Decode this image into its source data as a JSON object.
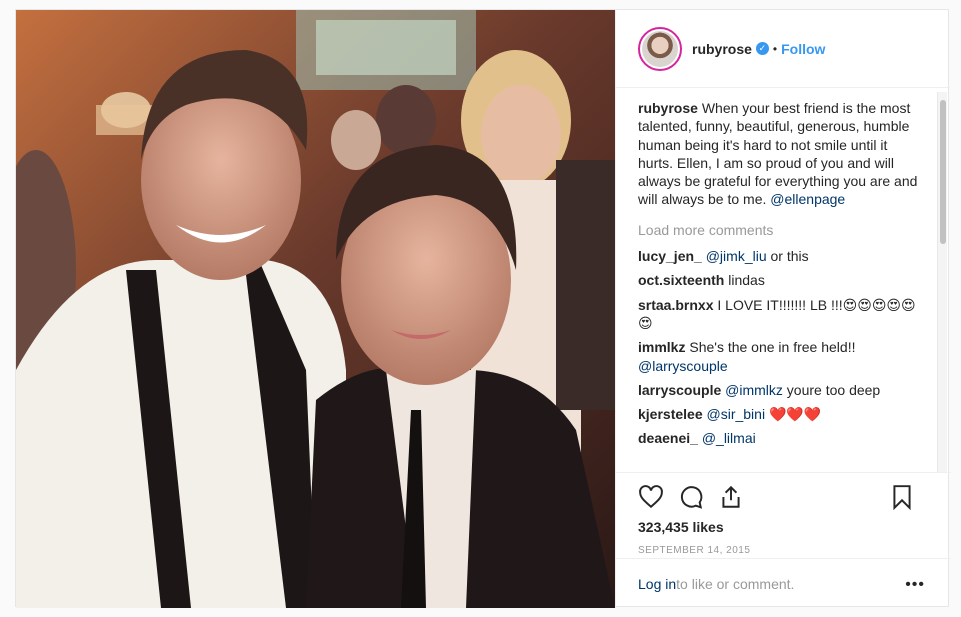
{
  "post": {
    "username": "rubyrose",
    "follow_label": "Follow",
    "caption_user": "rubyrose",
    "caption_text": "When your best friend is the most talented, funny, beautiful, generous, humble human being it's hard to not smile until it hurts. Ellen, I am so proud of you and will always be grateful for everything you are and will always be to me.",
    "caption_mention": "@ellenpage",
    "load_more": "Load more comments",
    "comments": [
      {
        "user": "lucy_jen_",
        "mention": "@jimk_liu",
        "text": " or this"
      },
      {
        "user": "oct.sixteenth",
        "mention": "",
        "text": " lindas"
      },
      {
        "user": "srtaa.brnxx",
        "mention": "",
        "text": " I LOVE IT!!!!!!! LB !!!😍😍😍😍😍😍"
      },
      {
        "user": "immlkz",
        "mention": "",
        "text": " She's the one in free held!!",
        "mention2": "@larryscouple"
      },
      {
        "user": "larryscouple",
        "mention": "@immlkz",
        "text": " youre too deep"
      },
      {
        "user": "kjerstelee",
        "mention": "@sir_bini",
        "text": " ❤️❤️❤️"
      },
      {
        "user": "deaenei_",
        "mention": "@_lilmai",
        "text": ""
      }
    ],
    "likes": "323,435 likes",
    "date": "SEPTEMBER 14, 2015",
    "login_link": "Log in",
    "login_rest": " to like or comment.",
    "more_options": "•••"
  },
  "icons": {
    "like": "heart-icon",
    "comment": "comment-icon",
    "share": "share-icon",
    "save": "bookmark-icon",
    "verified": "verified-badge-icon"
  },
  "colors": {
    "accent": "#3897f0",
    "link": "#003569",
    "muted": "#999999",
    "text": "#262626"
  }
}
